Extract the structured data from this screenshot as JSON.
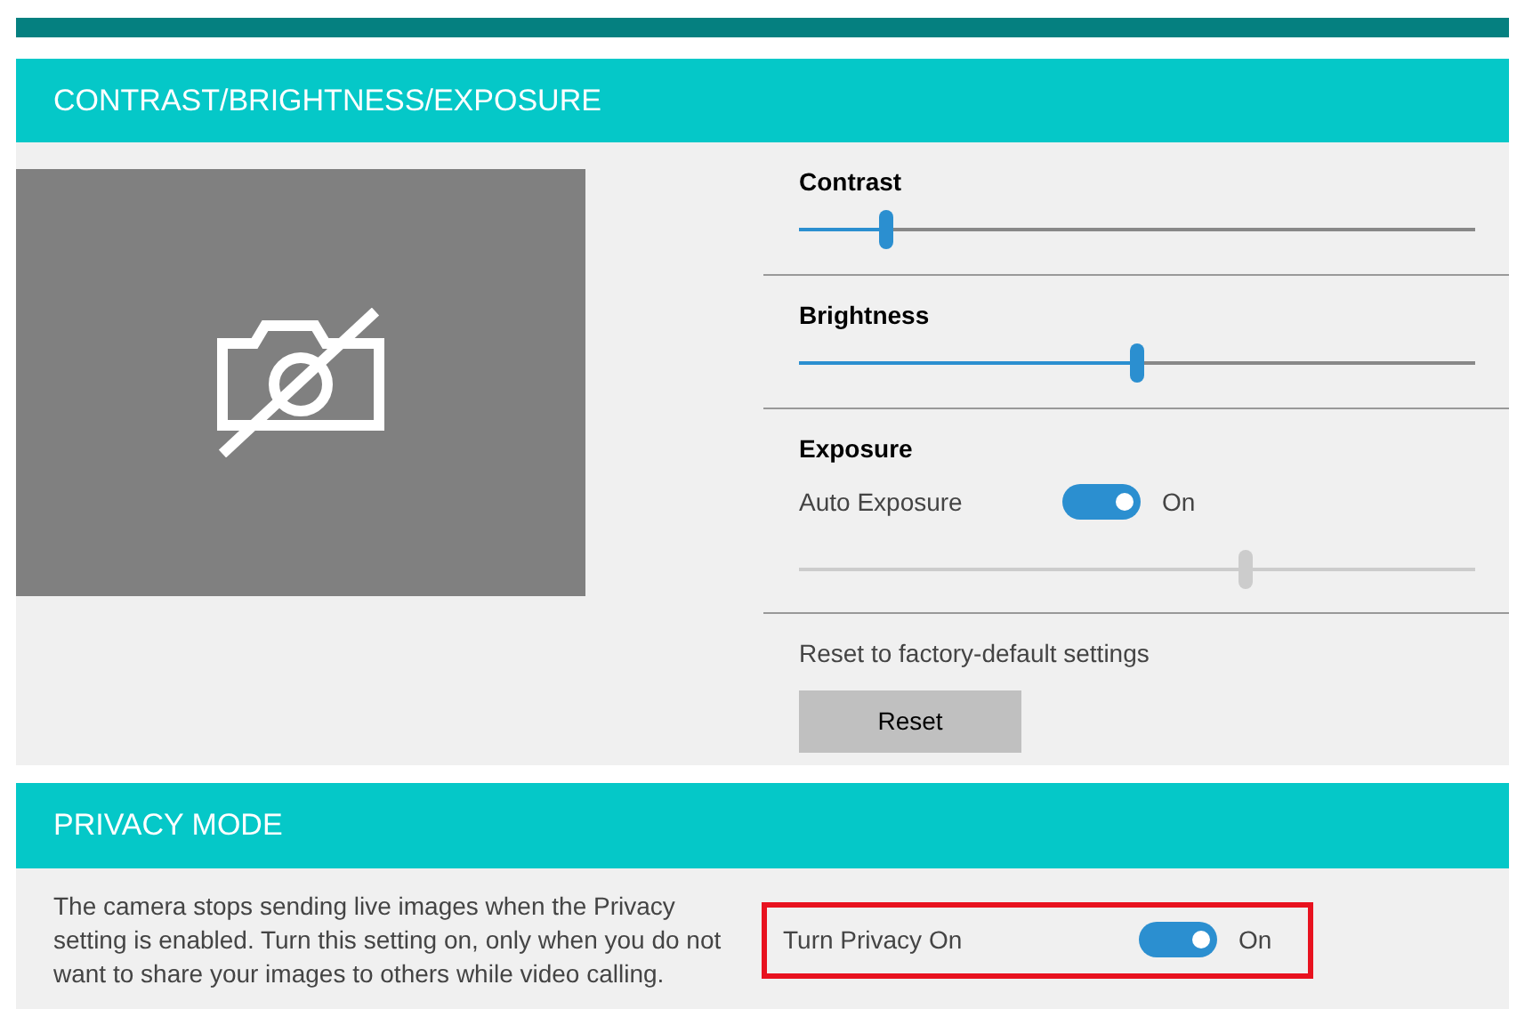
{
  "image_section": {
    "title": "CONTRAST/BRIGHTNESS/EXPOSURE",
    "sliders": [
      {
        "label": "Contrast",
        "level": 0.13
      },
      {
        "label": "Brightness",
        "level": 0.5
      }
    ],
    "exposure": {
      "label": "Exposure",
      "auto_label": "Auto Exposure",
      "auto_on": true,
      "auto_state": "On",
      "level": 0.66,
      "disabled": true
    },
    "reset": {
      "caption": "Reset to factory-default settings",
      "button": "Reset"
    }
  },
  "privacy_section": {
    "title": "PRIVACY MODE",
    "description": "The camera stops sending live images when the Privacy setting is enabled. Turn this setting on, only when you do not want to share your images to others while video calling.",
    "toggle": {
      "label": "Turn Privacy On",
      "on": true,
      "state": "On",
      "highlighted": true
    }
  }
}
